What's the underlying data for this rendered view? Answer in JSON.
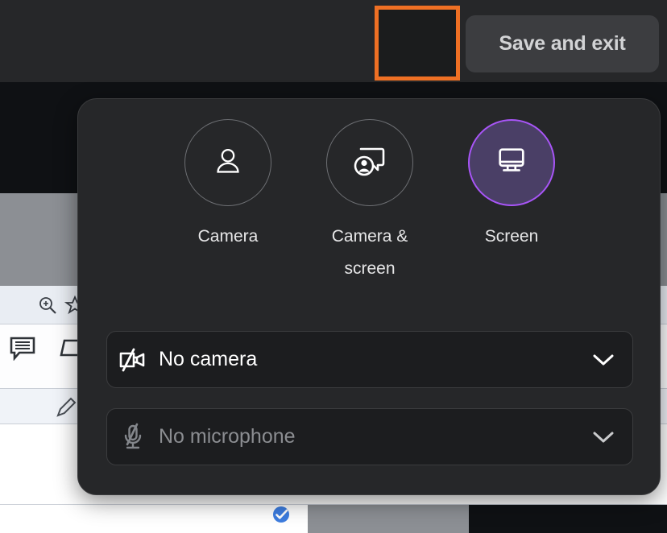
{
  "topbar": {
    "gear_button": {
      "icon": "gear-icon",
      "highlighted": true,
      "highlight_color": "#ef7024"
    },
    "save_exit_label": "Save and exit",
    "background_color": "#262729",
    "button_color": "#3c3d40"
  },
  "settings_panel": {
    "background_color": "#262729",
    "modes": [
      {
        "label": "Camera",
        "icon": "person-icon",
        "selected": false
      },
      {
        "label": "Camera & screen",
        "icon": "person-screen-icon",
        "selected": false
      },
      {
        "label": "Screen",
        "icon": "monitor-icon",
        "selected": true
      }
    ],
    "selected_accent_color": "#a855f7",
    "selected_fill_color": "#4a3f66",
    "camera_select": {
      "value": "No camera",
      "icon": "camera-off-icon",
      "chevron": "chevron-down-icon",
      "disabled": false
    },
    "microphone_select": {
      "value": "No microphone",
      "icon": "microphone-off-icon",
      "chevron": "chevron-down-icon",
      "disabled": true
    }
  },
  "backdrop": {
    "icons": [
      "zoom-in-icon",
      "star-icon",
      "comment-icon",
      "shape-icon",
      "pencil-icon",
      "check-circle-icon"
    ],
    "check_icon_color": "#3d7de0"
  }
}
